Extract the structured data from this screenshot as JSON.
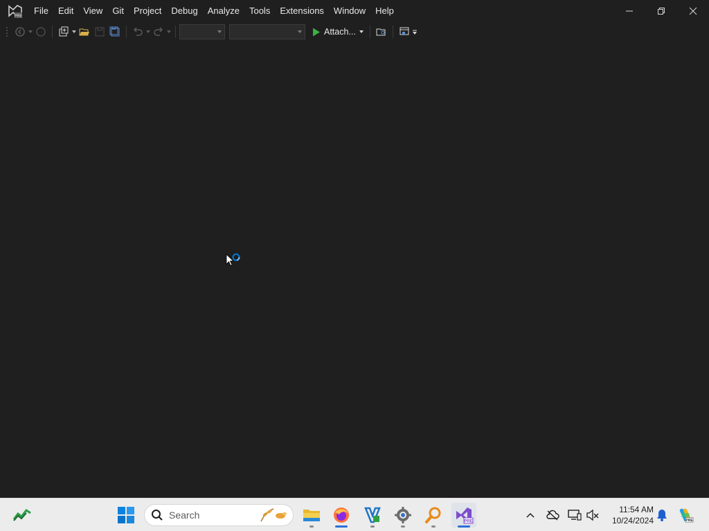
{
  "window": {
    "app_logo_badge": "PRE",
    "menu": [
      "File",
      "Edit",
      "View",
      "Git",
      "Project",
      "Debug",
      "Analyze",
      "Tools",
      "Extensions",
      "Window",
      "Help"
    ],
    "controls": [
      "minimize-icon",
      "restore-icon",
      "close-icon"
    ]
  },
  "toolbar": {
    "attach_label": "Attach...",
    "config_combo_value": "",
    "platform_combo_value": ""
  },
  "taskbar": {
    "search_placeholder": "Search",
    "apps": [
      "file-explorer",
      "firefox",
      "visual-studio-installer",
      "settings",
      "search-tool",
      "visual-studio-preview"
    ],
    "active_app": "visual-studio-preview",
    "app_badge": "PRE",
    "clock": {
      "time": "11:54 AM",
      "date": "10/24/2024"
    }
  },
  "colors": {
    "background": "#1f1f1f",
    "accent": "#0078d4",
    "run_green": "#3cb043",
    "vs_purple": "#7c4dcc"
  }
}
